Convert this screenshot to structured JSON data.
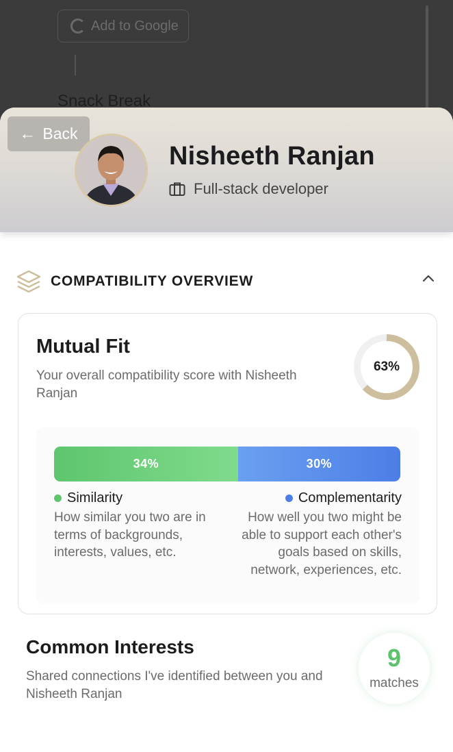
{
  "background": {
    "add_to_google_label": "Add to Google",
    "event_title": "Snack Break"
  },
  "profile": {
    "back_label": "Back",
    "name": "Nisheeth Ranjan",
    "role": "Full-stack developer"
  },
  "compatibility": {
    "section_title": "COMPATIBILITY OVERVIEW",
    "card_title": "Mutual Fit",
    "card_subtitle": "Your overall compatibility score with Nisheeth Ranjan",
    "score_label": "63%",
    "score_value": 63,
    "similarity": {
      "percent_label": "34%",
      "value": 34,
      "title": "Similarity",
      "description": "How similar you two are in terms of backgrounds, interests, values, etc.",
      "color": "#5fc56e"
    },
    "complementarity": {
      "percent_label": "30%",
      "value": 30,
      "title": "Complementarity",
      "description": "How well you two might be able to support each other's goals based on skills, network, experiences, etc.",
      "color": "#4c7ee6"
    }
  },
  "common_interests": {
    "title": "Common Interests",
    "subtitle": "Shared connections I've identified between you and Nisheeth Ranjan",
    "count": "9",
    "count_label": "matches"
  },
  "colors": {
    "accent_gold": "#cdbf9e",
    "match_green": "#5cc36c"
  },
  "icons": {
    "back": "arrow-left-icon",
    "role": "briefcase-icon",
    "section": "layers-icon",
    "collapse": "chevron-up-icon"
  }
}
